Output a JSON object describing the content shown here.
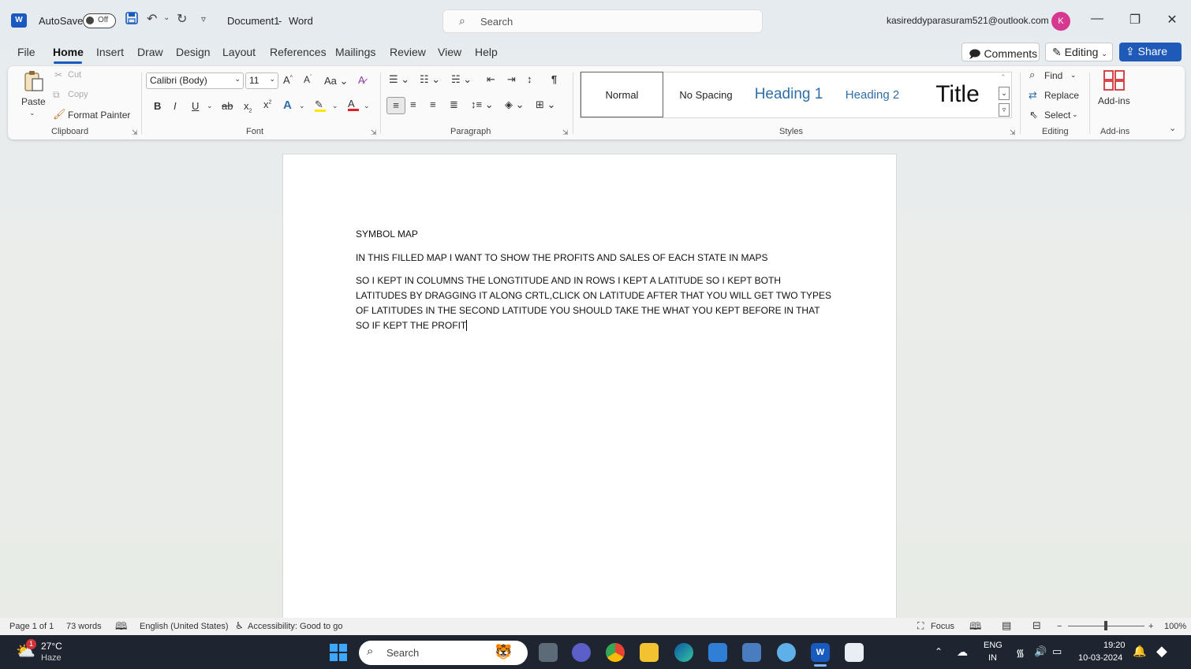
{
  "titlebar": {
    "autosave_label": "AutoSave",
    "autosave_state": "Off",
    "doc_title": "Document1",
    "separator": "-",
    "app_name": "Word",
    "search_placeholder": "Search",
    "account": "kasireddyparasuram521@outlook.com",
    "avatar_initial": "K"
  },
  "tabs": [
    "File",
    "Home",
    "Insert",
    "Draw",
    "Design",
    "Layout",
    "References",
    "Mailings",
    "Review",
    "View",
    "Help"
  ],
  "actions": {
    "comments": "Comments",
    "editing": "Editing",
    "share": "Share"
  },
  "ribbon": {
    "clipboard": {
      "paste": "Paste",
      "cut": "Cut",
      "copy": "Copy",
      "format_painter": "Format Painter",
      "label": "Clipboard"
    },
    "font": {
      "family": "Calibri (Body)",
      "size": "11",
      "label": "Font"
    },
    "paragraph": {
      "label": "Paragraph"
    },
    "styles": {
      "items": [
        "Normal",
        "No Spacing",
        "Heading 1",
        "Heading 2",
        "Title"
      ],
      "label": "Styles"
    },
    "editing": {
      "find": "Find",
      "replace": "Replace",
      "select": "Select",
      "label": "Editing"
    },
    "addins": {
      "button": "Add-ins",
      "label": "Add-ins"
    }
  },
  "document": {
    "lines": [
      "SYMBOL MAP",
      "IN THIS FILLED MAP I WANT TO SHOW THE PROFITS AND SALES OF EACH STATE IN MAPS",
      "SO I KEPT IN COLUMNS THE LONGTITUDE AND IN ROWS I KEPT A LATITUDE SO I KEPT BOTH",
      "LATITUDES BY DRAGGING IT ALONG CRTL,CLICK ON LATITUDE AFTER THAT YOU WILL GET TWO TYPES",
      "OF LATITUDES IN THE SECOND LATITUDE YOU SHOULD TAKE THE WHAT YOU KEPT BEFORE IN THAT",
      "SO IF KEPT THE PROFIT"
    ]
  },
  "statusbar": {
    "page": "Page 1 of 1",
    "words": "73 words",
    "language": "English (United States)",
    "accessibility": "Accessibility: Good to go",
    "focus": "Focus",
    "zoom": "100%"
  },
  "taskbar": {
    "weather_temp": "27°C",
    "weather_desc": "Haze",
    "weather_badge": "1",
    "search": "Search",
    "lang_top": "ENG",
    "lang_bottom": "IN",
    "time": "19:20",
    "date": "10-03-2024"
  },
  "colors": {
    "word_blue": "#185abd",
    "share_blue": "#1f5ab9",
    "avatar": "#d6388f",
    "heading_blue": "#2f6ea8",
    "taskbar": "#1e2530"
  }
}
